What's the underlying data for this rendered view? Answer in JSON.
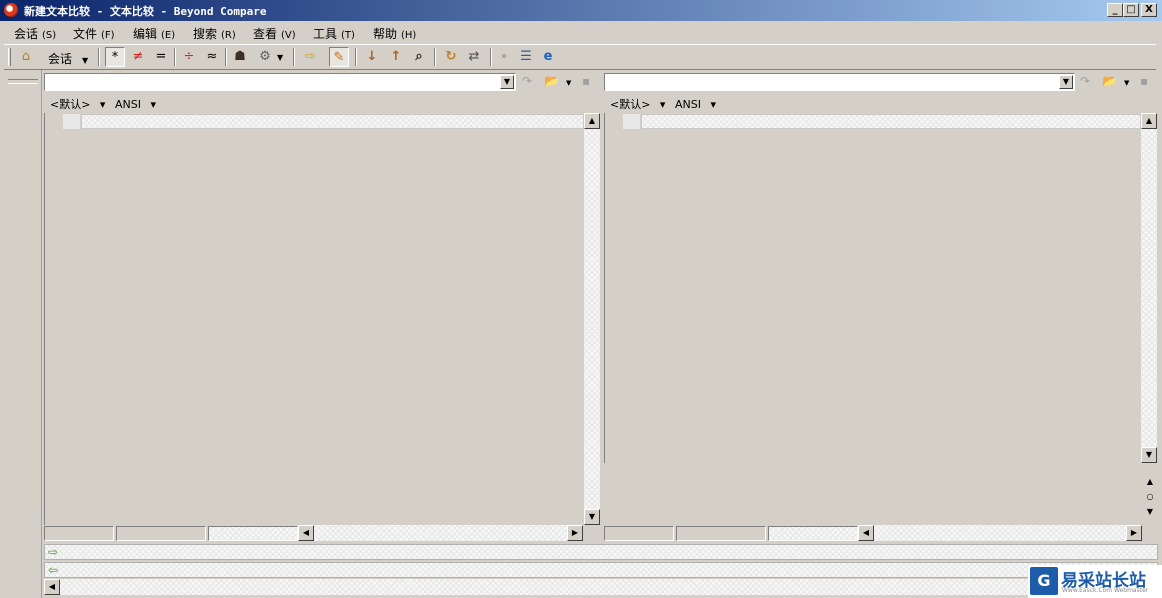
{
  "window": {
    "title": "新建文本比较 - 文本比较 - Beyond Compare",
    "minimize": "_",
    "maximize": "□",
    "close": "X"
  },
  "menu": [
    {
      "label": "会话",
      "accel": "(S)"
    },
    {
      "label": "文件",
      "accel": "(F)"
    },
    {
      "label": "编辑",
      "accel": "(E)"
    },
    {
      "label": "搜索",
      "accel": "(R)"
    },
    {
      "label": "查看",
      "accel": "(V)"
    },
    {
      "label": "工具",
      "accel": "(T)"
    },
    {
      "label": "帮助",
      "accel": "(H)"
    }
  ],
  "toolbar": {
    "session_label": "会话",
    "icons": {
      "home": "⌂",
      "all": "*",
      "diffs": "≠",
      "same": "=",
      "context": "÷",
      "minor": "≈",
      "rules": "☗",
      "format": "⚙",
      "next_section": "⇨",
      "edit": "✎",
      "next_diff": "↓",
      "prev_diff": "↑",
      "find": "⌕",
      "refresh": "↻",
      "swap": "⇄",
      "expand": "»",
      "list": "☰",
      "web": "e"
    }
  },
  "left": {
    "encoding_default": "<默认>",
    "encoding_charset": "ANSI",
    "path_value": ""
  },
  "right": {
    "encoding_default": "<默认>",
    "encoding_charset": "ANSI",
    "path_value": ""
  },
  "nav": {
    "up": "▲",
    "mid": "○",
    "down": "▼"
  },
  "bottom": {
    "next_arrow": "⇨",
    "prev_arrow": "⇦"
  },
  "watermark": {
    "logo": "G",
    "text": "易采站长站",
    "sub": "Www.Easck.Com Webmaster"
  },
  "colors": {
    "title_start": "#0a246a",
    "title_end": "#a6caf0",
    "chrome": "#d4d0c8"
  }
}
